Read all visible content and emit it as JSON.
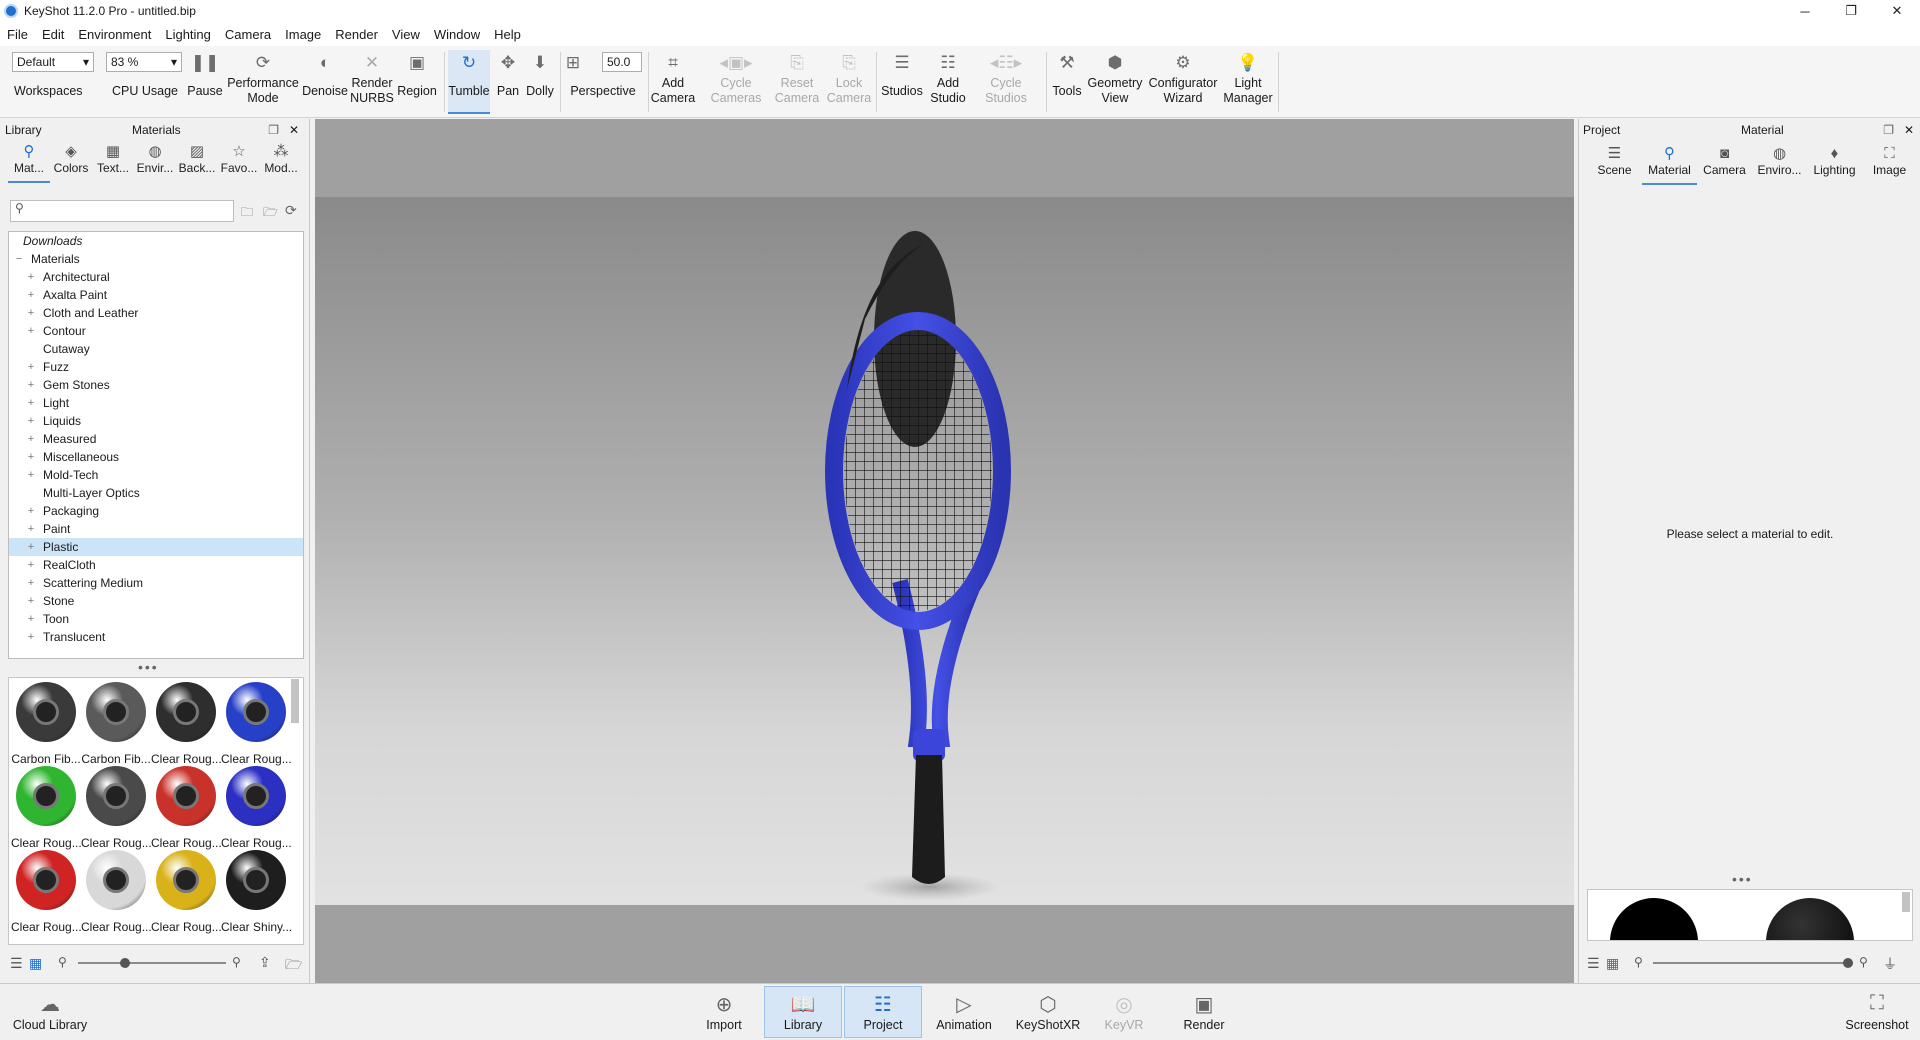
{
  "titlebar": {
    "title": "KeyShot 11.2.0 Pro  - untitled.bip",
    "minimize": "─",
    "maximize": "❐",
    "close": "✕"
  },
  "menu": [
    "File",
    "Edit",
    "Environment",
    "Lighting",
    "Camera",
    "Image",
    "Render",
    "View",
    "Window",
    "Help"
  ],
  "toolbar": {
    "workspace_value": "Default",
    "cpu_value": "83 %",
    "perspective_value": "50.0",
    "items": {
      "workspaces": "Workspaces",
      "cpu_usage": "CPU Usage",
      "pause": "Pause",
      "performance_mode": "Performance\nMode",
      "denoise": "Denoise",
      "render_nurbs": "Render\nNURBS",
      "region": "Region",
      "tumble": "Tumble",
      "pan": "Pan",
      "dolly": "Dolly",
      "perspective": "Perspective",
      "add_camera": "Add\nCamera",
      "cycle_cameras": "Cycle\nCameras",
      "reset_camera": "Reset\nCamera",
      "lock_camera": "Lock\nCamera",
      "studios": "Studios",
      "add_studio": "Add\nStudio",
      "cycle_studios": "Cycle\nStudios",
      "tools": "Tools",
      "geometry_view": "Geometry\nView",
      "configurator_wizard": "Configurator\nWizard",
      "light_manager": "Light\nManager"
    }
  },
  "library": {
    "header_left": "Library",
    "header_center": "Materials",
    "tabs": [
      "Mat...",
      "Colors",
      "Text...",
      "Envir...",
      "Back...",
      "Favo...",
      "Mod..."
    ],
    "tree": [
      {
        "label": "Downloads",
        "pm": "",
        "indent": 0,
        "italic": true
      },
      {
        "label": "Materials",
        "pm": "−",
        "indent": 0
      },
      {
        "label": "Architectural",
        "pm": "+",
        "indent": 1
      },
      {
        "label": "Axalta Paint",
        "pm": "+",
        "indent": 1
      },
      {
        "label": "Cloth and Leather",
        "pm": "+",
        "indent": 1
      },
      {
        "label": "Contour",
        "pm": "+",
        "indent": 1
      },
      {
        "label": "Cutaway",
        "pm": "",
        "indent": 1
      },
      {
        "label": "Fuzz",
        "pm": "+",
        "indent": 1
      },
      {
        "label": "Gem Stones",
        "pm": "+",
        "indent": 1
      },
      {
        "label": "Light",
        "pm": "+",
        "indent": 1
      },
      {
        "label": "Liquids",
        "pm": "+",
        "indent": 1
      },
      {
        "label": "Measured",
        "pm": "+",
        "indent": 1
      },
      {
        "label": "Miscellaneous",
        "pm": "+",
        "indent": 1
      },
      {
        "label": "Mold-Tech",
        "pm": "+",
        "indent": 1
      },
      {
        "label": "Multi-Layer Optics",
        "pm": "",
        "indent": 1
      },
      {
        "label": "Packaging",
        "pm": "+",
        "indent": 1
      },
      {
        "label": "Paint",
        "pm": "+",
        "indent": 1
      },
      {
        "label": "Plastic",
        "pm": "+",
        "indent": 1,
        "selected": true
      },
      {
        "label": "RealCloth",
        "pm": "+",
        "indent": 1
      },
      {
        "label": "Scattering Medium",
        "pm": "+",
        "indent": 1
      },
      {
        "label": "Stone",
        "pm": "+",
        "indent": 1
      },
      {
        "label": "Toon",
        "pm": "+",
        "indent": 1
      },
      {
        "label": "Translucent",
        "pm": "+",
        "indent": 1
      }
    ],
    "thumbnails": [
      {
        "label": "Carbon Fib...",
        "color": "#3a3a3a"
      },
      {
        "label": "Carbon Fib...",
        "color": "#5a5a5a"
      },
      {
        "label": "Clear Roug...",
        "color": "#2e2e2e"
      },
      {
        "label": "Clear Roug...",
        "color": "#2740c8"
      },
      {
        "label": "Clear Roug...",
        "color": "#2fb52f"
      },
      {
        "label": "Clear Roug...",
        "color": "#4a4a4a"
      },
      {
        "label": "Clear Roug...",
        "color": "#c9322b"
      },
      {
        "label": "Clear Roug...",
        "color": "#2b2fc2"
      },
      {
        "label": "Clear Roug...",
        "color": "#d02424"
      },
      {
        "label": "Clear Roug...",
        "color": "#d8d8d8"
      },
      {
        "label": "Clear Roug...",
        "color": "#d9b21a"
      },
      {
        "label": "Clear Shiny...",
        "color": "#1e1e1e"
      }
    ]
  },
  "project": {
    "header_left": "Project",
    "header_center": "Material",
    "tabs": [
      "Scene",
      "Material",
      "Camera",
      "Enviro...",
      "Lighting",
      "Image"
    ],
    "empty_message": "Please select a material to edit."
  },
  "bottombar": {
    "cloud_library": "Cloud Library",
    "import": "Import",
    "library": "Library",
    "project": "Project",
    "animation": "Animation",
    "keyshotxr": "KeyShotXR",
    "keyvr": "KeyVR",
    "render": "Render",
    "screenshot": "Screenshot"
  },
  "colors": {
    "accent": "#1f6fd1",
    "racket": "#3b45d9",
    "grip": "#1c1c1c"
  }
}
